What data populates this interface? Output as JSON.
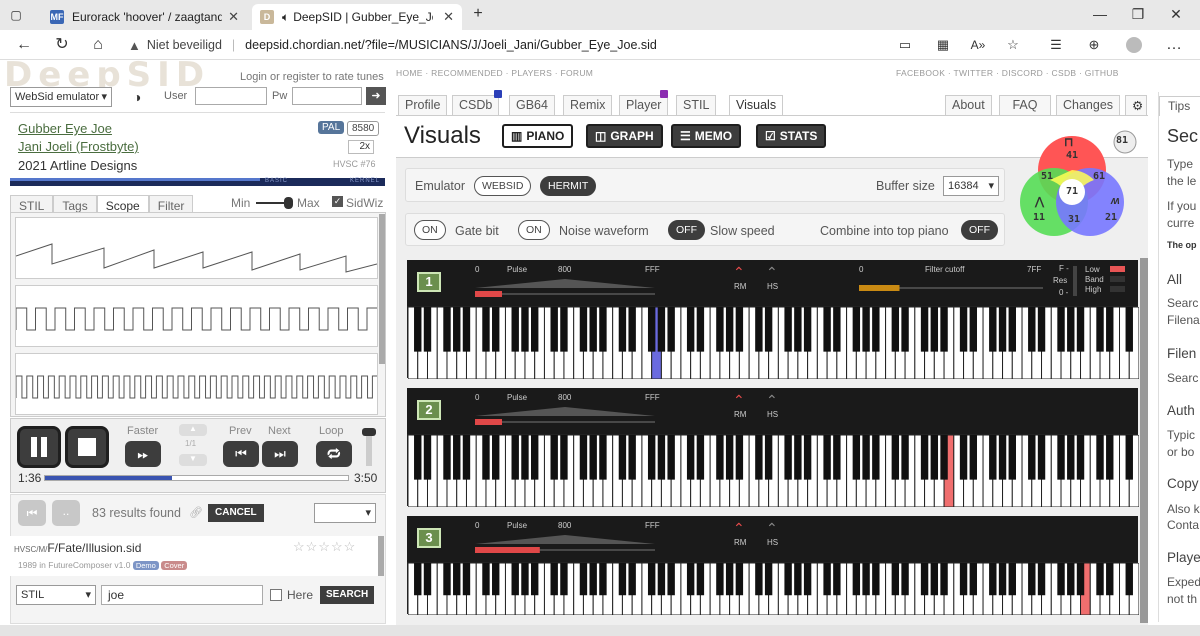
{
  "browser": {
    "tabs": [
      {
        "label": "Eurorack 'hoover' / zaagtand-me",
        "favicon": "MF"
      },
      {
        "label": "DeepSID | Gubber_Eye_Joe.",
        "favicon": "D"
      }
    ],
    "url_warning": "Niet beveiligd",
    "url": "deepsid.chordian.net/?file=/MUSICIANS/J/Joeli_Jani/Gubber_Eye_Joe.sid"
  },
  "header": {
    "logo": "DeepSID",
    "login_text": "Login or register to rate tunes",
    "emulator_select": "WebSid emulator",
    "user_label": "User",
    "pw_label": "Pw",
    "nav_left": "HOME · RECOMMENDED · PLAYERS · FORUM",
    "nav_right": "FACEBOOK · TWITTER · DISCORD · CSDB · GITHUB"
  },
  "song": {
    "title": "Gubber Eye Joe",
    "author": "Jani Joeli (Frostbyte)",
    "copyright": "2021 Artline Designs",
    "video": "PAL",
    "chip": "8580",
    "speed": "2x",
    "hvsc": "HVSC #76",
    "chip_labels": [
      "BASIC",
      "KERNEL"
    ]
  },
  "left_tabs": [
    "STIL",
    "Tags",
    "Scope",
    "Filter"
  ],
  "scope": {
    "min_label": "Min",
    "max_label": "Max",
    "sidwiz_label": "SidWiz"
  },
  "controls": {
    "faster": "Faster",
    "subtune": "1/1",
    "prev": "Prev",
    "next": "Next",
    "loop": "Loop",
    "time_elapsed": "1:36",
    "time_total": "3:50",
    "progress": 0.42
  },
  "results": {
    "count_text": "83 results found",
    "cancel": "CANCEL",
    "item_path_prefix": "HVSC/M/",
    "item_path_name": "F/Fate/Illusion.sid",
    "item_meta": "1989 in FutureComposer v1.0",
    "tags": [
      "Demo",
      "Cover"
    ],
    "search_type": "STIL",
    "search_value": "joe",
    "here_label": "Here",
    "search_button": "SEARCH"
  },
  "view_tabs": [
    "Profile",
    "CSDb",
    "GB64",
    "Remix",
    "Player",
    "STIL",
    "Visuals"
  ],
  "right_tabs": [
    "About",
    "FAQ",
    "Changes"
  ],
  "visuals": {
    "title": "Visuals",
    "buttons": [
      "PIANO",
      "GRAPH",
      "MEMO",
      "STATS"
    ],
    "emulator_label": "Emulator",
    "emulators": [
      "WEBSID",
      "HERMIT"
    ],
    "buffer_label": "Buffer size",
    "buffer_value": "16384",
    "gate_on": "ON",
    "gate_label": "Gate bit",
    "noise_on": "ON",
    "noise_label": "Noise waveform",
    "slow_off": "OFF",
    "slow_label": "Slow speed",
    "combine_label": "Combine into top piano",
    "combine_off": "OFF"
  },
  "venn": {
    "total": "81",
    "top": "41",
    "left": "11",
    "right": "21",
    "tl": "51",
    "tr": "61",
    "center": "71",
    "bottom": "31",
    "colors": {
      "top": "#ff5555",
      "left": "#55dd55",
      "right": "#7777ff",
      "center": "#ffffff"
    }
  },
  "pianos": [
    {
      "voice": "1",
      "pulse_label": "Pulse",
      "ticks": [
        "0",
        "800",
        "FFF"
      ],
      "pulse": 0.15,
      "rm": "RM",
      "hs": "HS",
      "filter": true,
      "filter_label": "Filter cutoff",
      "filter_ticks": [
        "0",
        "7FF"
      ],
      "cutoff": 0.22,
      "res_label": "Res",
      "res_ticks": [
        "F -",
        "0 -"
      ],
      "filter_modes": [
        "Low",
        "Band",
        "High"
      ],
      "note": 25,
      "note_color": "#6a6adf"
    },
    {
      "voice": "2",
      "pulse_label": "Pulse",
      "ticks": [
        "0",
        "800",
        "FFF"
      ],
      "pulse": 0.15,
      "rm": "RM",
      "hs": "HS",
      "filter": false,
      "note": 55,
      "note_color": "#f06e6e"
    },
    {
      "voice": "3",
      "pulse_label": "Pulse",
      "ticks": [
        "0",
        "800",
        "FFF"
      ],
      "pulse": 0.36,
      "rm": "RM",
      "hs": "HS",
      "filter": false,
      "note": 69,
      "note_color": "#f06e6e"
    }
  ],
  "tips": {
    "title": "Tips",
    "lines": [
      "Sec",
      "Type",
      "the le",
      "If you",
      "curre",
      "The op",
      "All",
      "Searc",
      "Filena",
      "Filen",
      "Searc",
      "Auth",
      "Typic",
      "or bo",
      "Copy",
      "Also k",
      "Conta",
      "Playe",
      "Exped",
      "not th"
    ]
  }
}
